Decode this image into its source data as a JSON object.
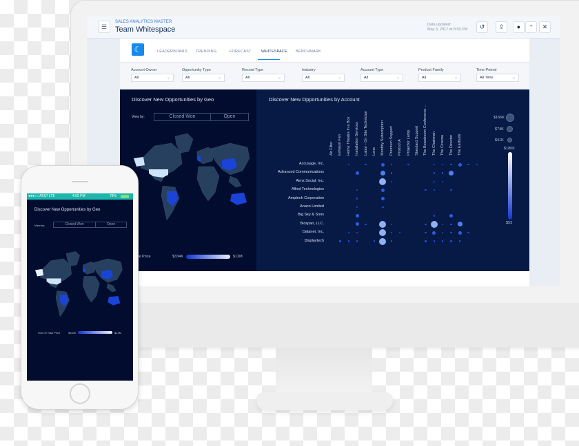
{
  "header": {
    "app_name": "SALES ANALYTICS MASTER",
    "dashboard_title": "Team Whitespace",
    "updated_label": "Data updated:",
    "updated_value": "May 3, 2017 at 8:50 PM",
    "icons": {
      "menu": "list-icon",
      "undo": "undo-icon",
      "share": "share-icon",
      "comment": "comment-icon",
      "notify": "bell-plus-icon",
      "close": "close-icon"
    }
  },
  "tabs": [
    {
      "label": "LEADERBOARD",
      "active": false
    },
    {
      "label": "TRENDING",
      "active": false
    },
    {
      "label": "FORECAST",
      "active": false
    },
    {
      "label": "WHITESPACE",
      "active": true
    },
    {
      "label": "BENCHMARK",
      "active": false
    }
  ],
  "filters": [
    {
      "label": "Account Owner",
      "value": "All"
    },
    {
      "label": "Opportunity Type",
      "value": "All"
    },
    {
      "label": "Record Type",
      "value": "All"
    },
    {
      "label": "Industry",
      "value": "All"
    },
    {
      "label": "Account Type",
      "value": "All"
    },
    {
      "label": "Product Family",
      "value": "All"
    },
    {
      "label": "Time Period",
      "value": "All Time"
    }
  ],
  "geo": {
    "title": "Discover New Opportunities by Geo",
    "view_by_label": "View by:",
    "toggle": [
      "Closed Won",
      "Open"
    ],
    "legend_label": "Sum of Total Price",
    "legend_min": "$334K",
    "legend_max": "$12M",
    "highlighted_regions": [
      "United States",
      "Brazil",
      "China",
      "Australia",
      "United Kingdom"
    ]
  },
  "account": {
    "title": "Discover New Opportunities by Account",
    "size_legend": [
      "$166K",
      "$74K",
      "$41K"
    ],
    "color_legend_max": "$180K",
    "color_legend_min": "$53"
  },
  "chart_data": {
    "type": "scatter",
    "title": "Discover New Opportunities by Account",
    "x_categories": [
      "Air Filter",
      "Exhaust Fan",
      "Home Theatre in a Box",
      "Installation Services",
      "Labor - On Site Technician",
      "Lens",
      "Monthly Subscription",
      "Premium Support",
      "Product A",
      "Projector Lamp",
      "Standard Support",
      "The Boardroom Conference ...",
      "The Chairman",
      "The Cinema",
      "The Director",
      "The Earbuds"
    ],
    "y_categories": [
      "Accusage, Inc.",
      "Advanced Communications",
      "Aims Social, Inc.",
      "Allied Technologies",
      "Amptech Corporation",
      "Anaco Limited",
      "Big Sky & Sons",
      "Biospan, LLC.",
      "Datanet, Inc.",
      "Displaytech"
    ],
    "size_legend": [
      "$166K",
      "$74K",
      "$41K"
    ],
    "color_range": [
      "$53",
      "$180K"
    ],
    "points": [
      {
        "x": "Home Theatre in a Box",
        "y": "Accusage, Inc.",
        "level": 1
      },
      {
        "x": "Labor - On Site Technician",
        "y": "Accusage, Inc.",
        "level": 1
      },
      {
        "x": "Monthly Subscription",
        "y": "Accusage, Inc.",
        "level": 2
      },
      {
        "x": "Premium Support",
        "y": "Accusage, Inc.",
        "level": 1
      },
      {
        "x": "Projector Lamp",
        "y": "Accusage, Inc.",
        "level": 1
      },
      {
        "x": "The Chairman",
        "y": "Accusage, Inc.",
        "level": 1
      },
      {
        "x": "The Cinema",
        "y": "Accusage, Inc.",
        "level": 1
      },
      {
        "x": "The Cinema",
        "y": "Accusage, Inc.",
        "level": 1
      },
      {
        "x": "The Cinema",
        "y": "Accusage, Inc.",
        "level": 2
      },
      {
        "x": "The Director",
        "y": "Accusage, Inc.",
        "level": 1
      },
      {
        "x": "The Earbuds",
        "y": "Accusage, Inc.",
        "level": 1
      },
      {
        "x": "Installation Services",
        "y": "Advanced Communications",
        "level": 2
      },
      {
        "x": "Monthly Subscription",
        "y": "Advanced Communications",
        "level": 3
      },
      {
        "x": "Premium Support",
        "y": "Advanced Communications",
        "level": 1
      },
      {
        "x": "The Chairman",
        "y": "Advanced Communications",
        "level": 1
      },
      {
        "x": "The Cinema",
        "y": "Advanced Communications",
        "level": 1
      },
      {
        "x": "The Director",
        "y": "Advanced Communications",
        "level": 3
      },
      {
        "x": "Monthly Subscription",
        "y": "Aims Social, Inc.",
        "level": 4
      },
      {
        "x": "Premium Support",
        "y": "Aims Social, Inc.",
        "level": 1
      },
      {
        "x": "The Chairman",
        "y": "Aims Social, Inc.",
        "level": 1
      },
      {
        "x": "The Cinema",
        "y": "Aims Social, Inc.",
        "level": 1
      },
      {
        "x": "Installation Services",
        "y": "Allied Technologies",
        "level": 1
      },
      {
        "x": "Monthly Subscription",
        "y": "Allied Technologies",
        "level": 2
      },
      {
        "x": "The Boardroom Conference ...",
        "y": "Allied Technologies",
        "level": 1
      },
      {
        "x": "The Chairman",
        "y": "Allied Technologies",
        "level": 1
      },
      {
        "x": "The Director",
        "y": "Allied Technologies",
        "level": 1
      },
      {
        "x": "Installation Services",
        "y": "Amptech Corporation",
        "level": 1
      },
      {
        "x": "Monthly Subscription",
        "y": "Amptech Corporation",
        "level": 2
      },
      {
        "x": "Installation Services",
        "y": "Anaco Limited",
        "level": 1
      },
      {
        "x": "Monthly Subscription",
        "y": "Anaco Limited",
        "level": 1
      },
      {
        "x": "Installation Services",
        "y": "Big Sky & Sons",
        "level": 2
      },
      {
        "x": "The Chairman",
        "y": "Big Sky & Sons",
        "level": 1
      },
      {
        "x": "The Director",
        "y": "Big Sky & Sons",
        "level": 2
      },
      {
        "x": "Installation Services",
        "y": "Biospan, LLC.",
        "level": 2
      },
      {
        "x": "Labor - On Site Technician",
        "y": "Biospan, LLC.",
        "level": 1
      },
      {
        "x": "Monthly Subscription",
        "y": "Biospan, LLC.",
        "level": 4
      },
      {
        "x": "Premium Support",
        "y": "Biospan, LLC.",
        "level": 1
      },
      {
        "x": "The Boardroom Conference ...",
        "y": "Biospan, LLC.",
        "level": 1
      },
      {
        "x": "The Chairman",
        "y": "Biospan, LLC.",
        "level": 4
      },
      {
        "x": "The Cinema",
        "y": "Biospan, LLC.",
        "level": 1
      },
      {
        "x": "The Cinema",
        "y": "Biospan, LLC.",
        "level": 1
      },
      {
        "x": "The Director",
        "y": "Biospan, LLC.",
        "level": 3
      },
      {
        "x": "Home Theatre in a Box",
        "y": "Datanet, Inc.",
        "level": 1
      },
      {
        "x": "Installation Services",
        "y": "Datanet, Inc.",
        "level": 1
      },
      {
        "x": "Monthly Subscription",
        "y": "Datanet, Inc.",
        "level": 4
      },
      {
        "x": "Premium Support",
        "y": "Datanet, Inc.",
        "level": 1
      },
      {
        "x": "Product A",
        "y": "Datanet, Inc.",
        "level": 1
      },
      {
        "x": "The Boardroom Conference ...",
        "y": "Datanet, Inc.",
        "level": 1
      },
      {
        "x": "The Chairman",
        "y": "Datanet, Inc.",
        "level": 2
      },
      {
        "x": "The Cinema",
        "y": "Datanet, Inc.",
        "level": 1
      },
      {
        "x": "The Cinema",
        "y": "Datanet, Inc.",
        "level": 1
      },
      {
        "x": "The Director",
        "y": "Datanet, Inc.",
        "level": 2
      },
      {
        "x": "The Earbuds",
        "y": "Datanet, Inc.",
        "level": 1
      },
      {
        "x": "Exhaust Fan",
        "y": "Displaytech",
        "level": 1
      },
      {
        "x": "Home Theatre in a Box",
        "y": "Displaytech",
        "level": 1
      },
      {
        "x": "Installation Services",
        "y": "Displaytech",
        "level": 1
      },
      {
        "x": "Lens",
        "y": "Displaytech",
        "level": 1
      },
      {
        "x": "Monthly Subscription",
        "y": "Displaytech",
        "level": 4
      },
      {
        "x": "Premium Support",
        "y": "Displaytech",
        "level": 1
      },
      {
        "x": "The Boardroom Conference ...",
        "y": "Displaytech",
        "level": 1
      },
      {
        "x": "The Chairman",
        "y": "Displaytech",
        "level": 1
      },
      {
        "x": "The Cinema",
        "y": "Displaytech",
        "level": 1
      },
      {
        "x": "The Director",
        "y": "Displaytech",
        "level": 1
      },
      {
        "x": "The Earbuds",
        "y": "Displaytech",
        "level": 1
      }
    ]
  },
  "phone": {
    "carrier": "●●●○○ AT&T  LTE",
    "time": "4:05 PM",
    "battery": "78%",
    "title": "Discover New Opportunities by Geo",
    "view_by_label": "View by:",
    "toggle": [
      "Closed Won",
      "Open"
    ],
    "legend_label": "Sum of Total Price",
    "legend_min": "$334K",
    "legend_max": "$12M"
  }
}
